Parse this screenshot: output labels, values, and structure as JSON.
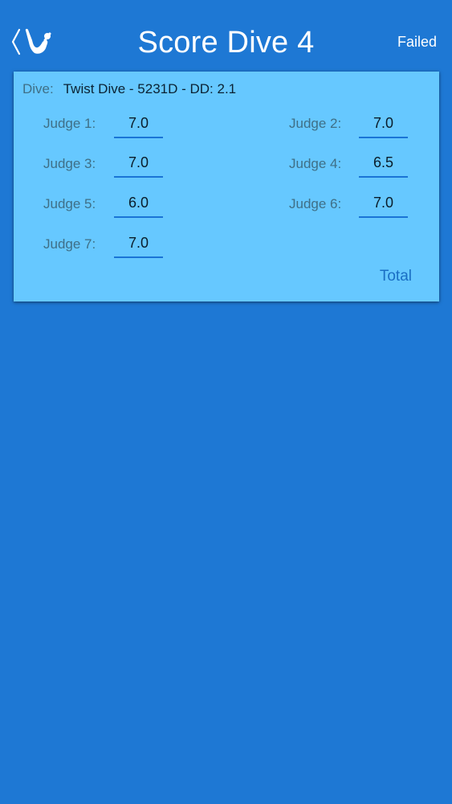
{
  "nav": {
    "title": "Score Dive 4",
    "back_icon": "diver-back-icon",
    "right_button": "Failed"
  },
  "dive": {
    "label": "Dive:",
    "value": "Twist Dive - 5231D - DD: 2.1"
  },
  "judges": [
    {
      "label": "Judge 1:",
      "score": "7.0"
    },
    {
      "label": "Judge 2:",
      "score": "7.0"
    },
    {
      "label": "Judge 3:",
      "score": "7.0"
    },
    {
      "label": "Judge 4:",
      "score": "6.5"
    },
    {
      "label": "Judge 5:",
      "score": "6.0"
    },
    {
      "label": "Judge 6:",
      "score": "7.0"
    },
    {
      "label": "Judge 7:",
      "score": "7.0"
    }
  ],
  "total_button": "Total",
  "colors": {
    "background": "#1e78d4",
    "card": "#66c8ff",
    "field_underline": "#1a74d6",
    "label_text": "#3f6f86",
    "link_text": "#1a6fc4"
  }
}
